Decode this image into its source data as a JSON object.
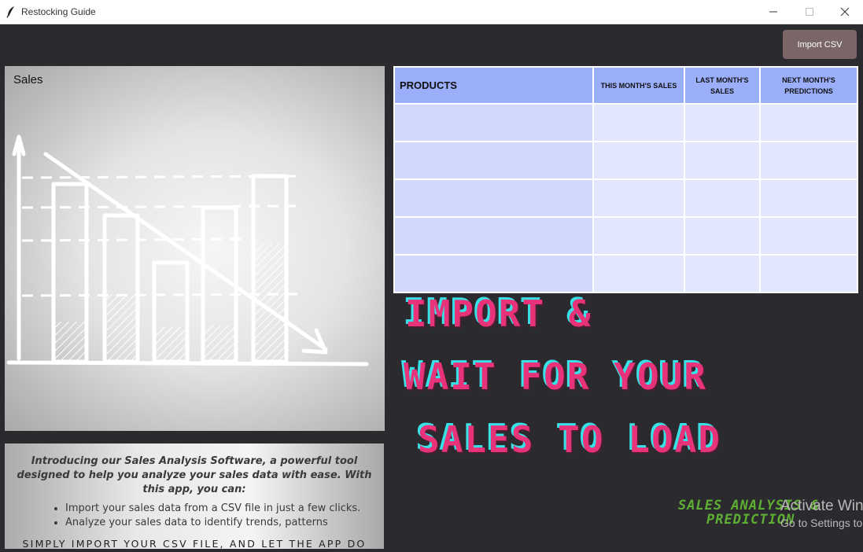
{
  "window": {
    "title": "Restocking Guide",
    "icon": "feather-icon",
    "controls": [
      "minimize-icon",
      "maximize-icon",
      "close-icon"
    ]
  },
  "toolbar": {
    "import_label": "Import CSV"
  },
  "sales_panel": {
    "label": "Sales"
  },
  "intro": {
    "text": "Introducing our Sales Analysis Software, a powerful tool designed to help you analyze your sales data with ease. With this app, you can:",
    "bullets": [
      "Import your sales data from a CSV file in just a few clicks.",
      "Analyze your sales data to identify trends, patterns"
    ],
    "tagline": "SIMPLY IMPORT YOUR CSV FILE, AND LET THE APP DO THE REST."
  },
  "table": {
    "headers": [
      "PRODUCTS",
      "THIS MONTH'S SALES",
      "LAST MONTH'S SALES",
      "NEXT MONTH'S PREDICTIONS"
    ],
    "rows": [
      [
        "",
        "",
        "",
        ""
      ],
      [
        "",
        "",
        "",
        ""
      ],
      [
        "",
        "",
        "",
        ""
      ],
      [
        "",
        "",
        "",
        ""
      ],
      [
        "",
        "",
        "",
        ""
      ]
    ]
  },
  "headline": {
    "line1": "IMPORT &",
    "line2": "WAIT FOR YOUR",
    "line3": "SALES TO LOAD"
  },
  "logo": {
    "line1": "SALES ANALYSIS &",
    "line2": "PREDICTION"
  },
  "activation": {
    "title": "Activate Win",
    "subtitle": "Go to Settings to"
  },
  "colors": {
    "background": "#2b2b2f",
    "import_button": "#7a6666",
    "table_header": "#9aaefa",
    "table_first_col": "#d0d8fd",
    "table_cells": "#e3e7fd",
    "headline_pink": "#e8337a",
    "headline_cyan": "#38e1e6",
    "logo_green": "#5fae34"
  }
}
